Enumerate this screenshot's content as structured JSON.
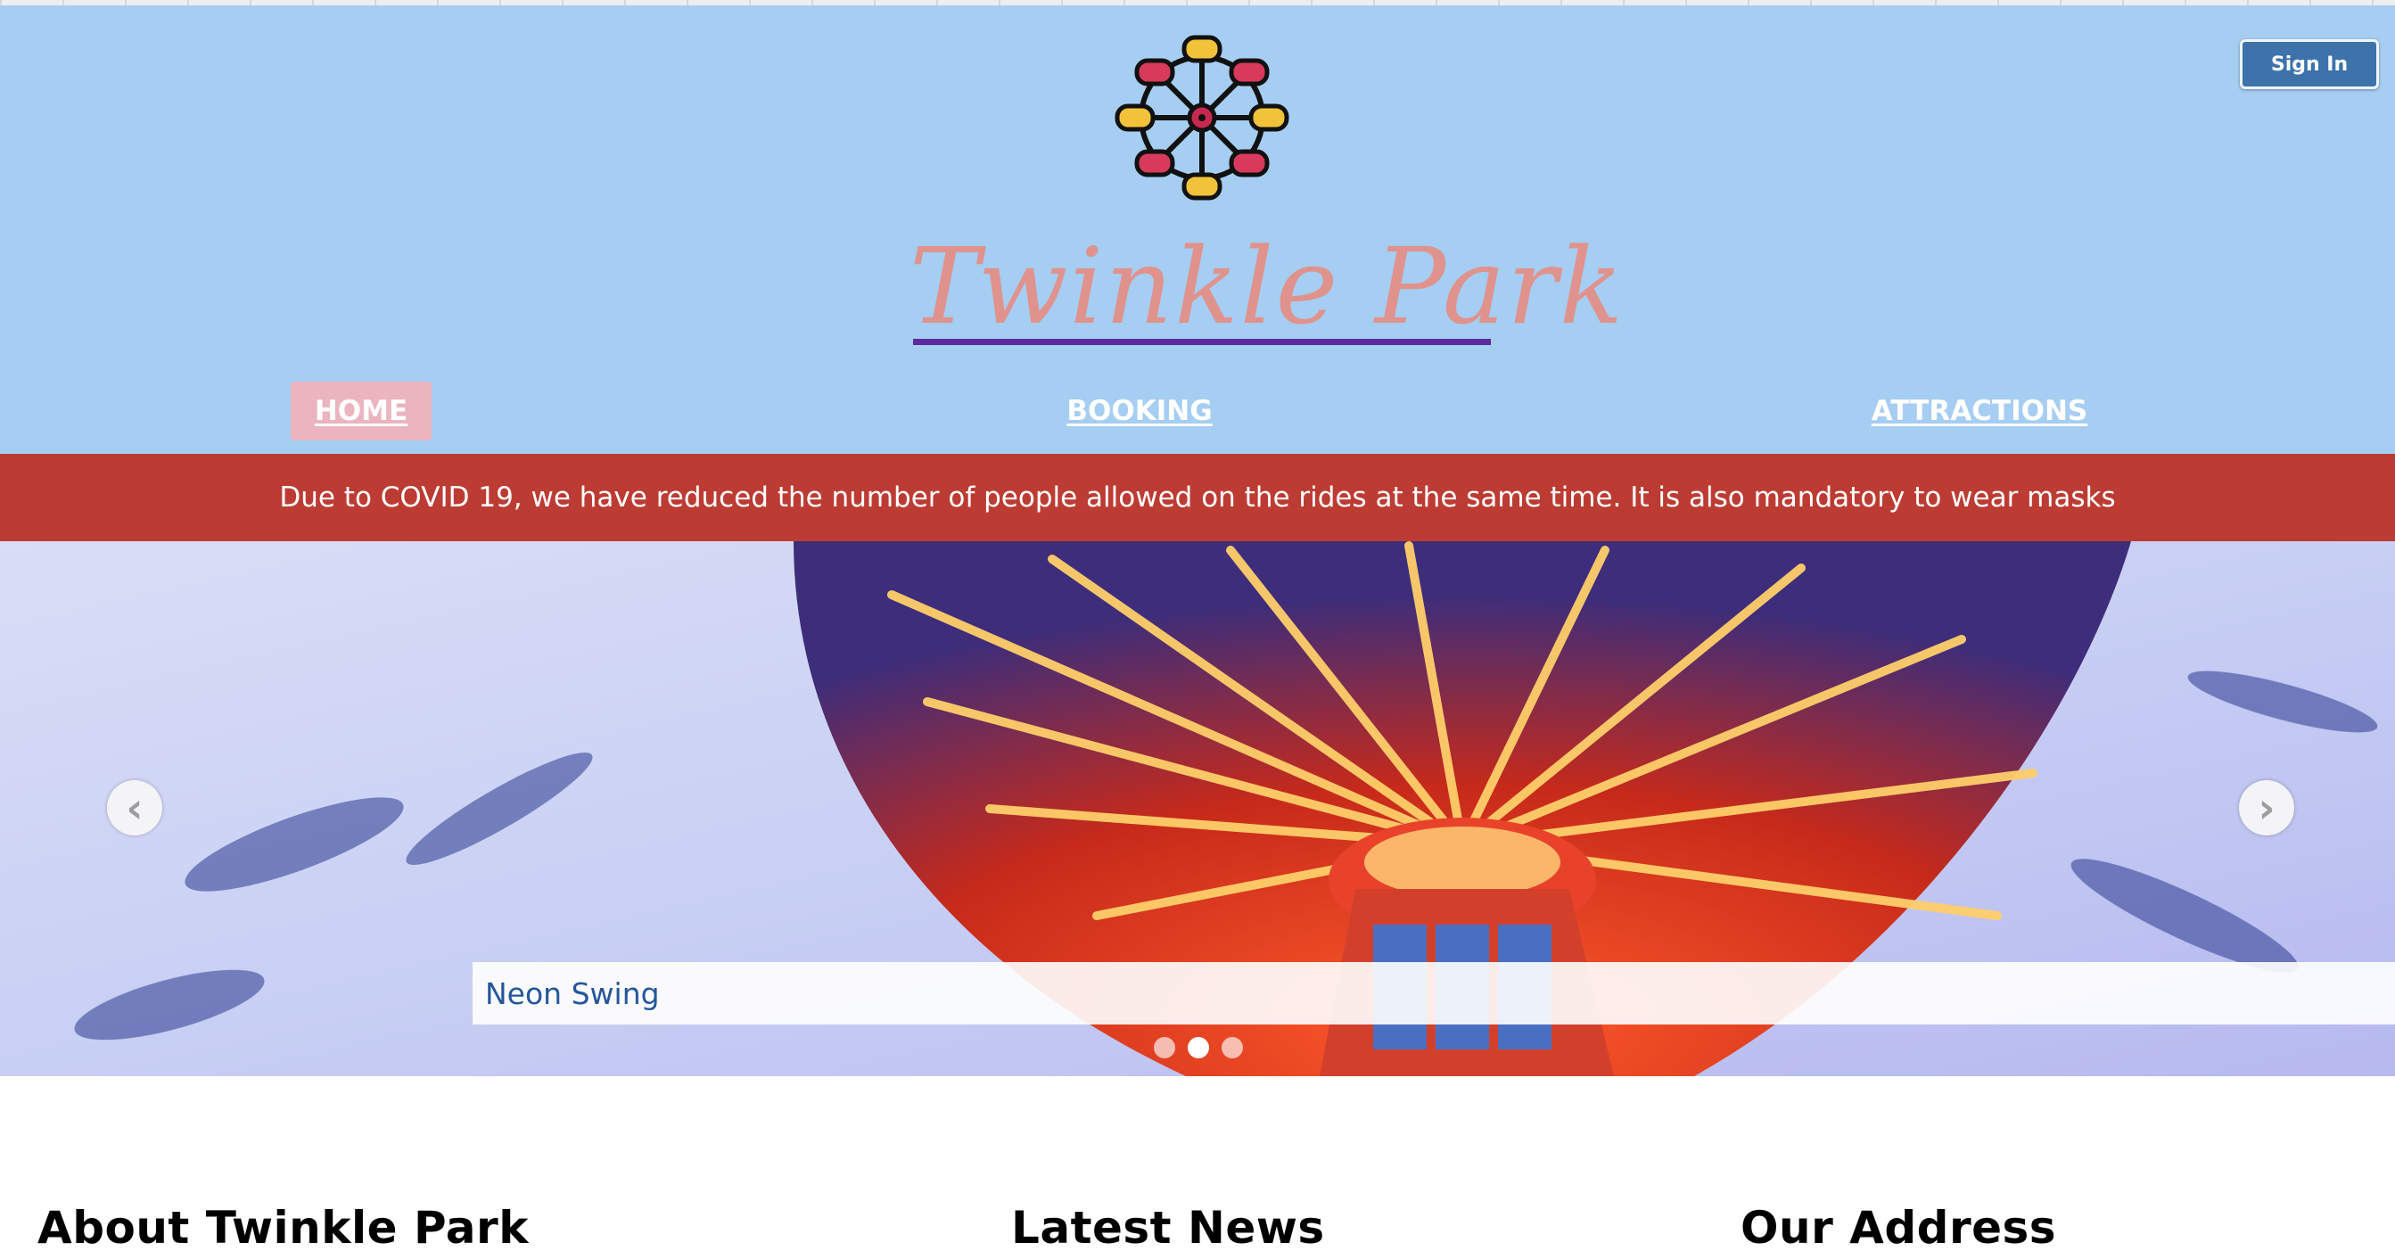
{
  "header": {
    "logo_icon": "ferris-wheel-icon",
    "brand_title": "Twinkle Park",
    "sign_in_label": "Sign In",
    "colors": {
      "header_bg": "#a6cdf2",
      "title": "#e0928c",
      "title_underline": "#5b2b9f",
      "sign_in_bg": "#3d73aa",
      "home_highlight": "#ecb4be"
    }
  },
  "nav": {
    "items": [
      {
        "label": "HOME",
        "active": true
      },
      {
        "label": "BOOKING",
        "active": false
      },
      {
        "label": "ATTRACTIONS",
        "active": false
      }
    ]
  },
  "banner": {
    "text": "Due to COVID 19, we have reduced the number of people allowed on the rides at the same time. It is also mandatory to wear masks",
    "color": "#bc3c33"
  },
  "carousel": {
    "caption": "Neon Swing",
    "prev_icon": "chevron-left-icon",
    "next_icon": "chevron-right-icon",
    "slide_count": 3,
    "active_slide": 2
  },
  "sections": [
    {
      "title": "About Twinkle Park"
    },
    {
      "title": "Latest News"
    },
    {
      "title": "Our Address"
    }
  ]
}
